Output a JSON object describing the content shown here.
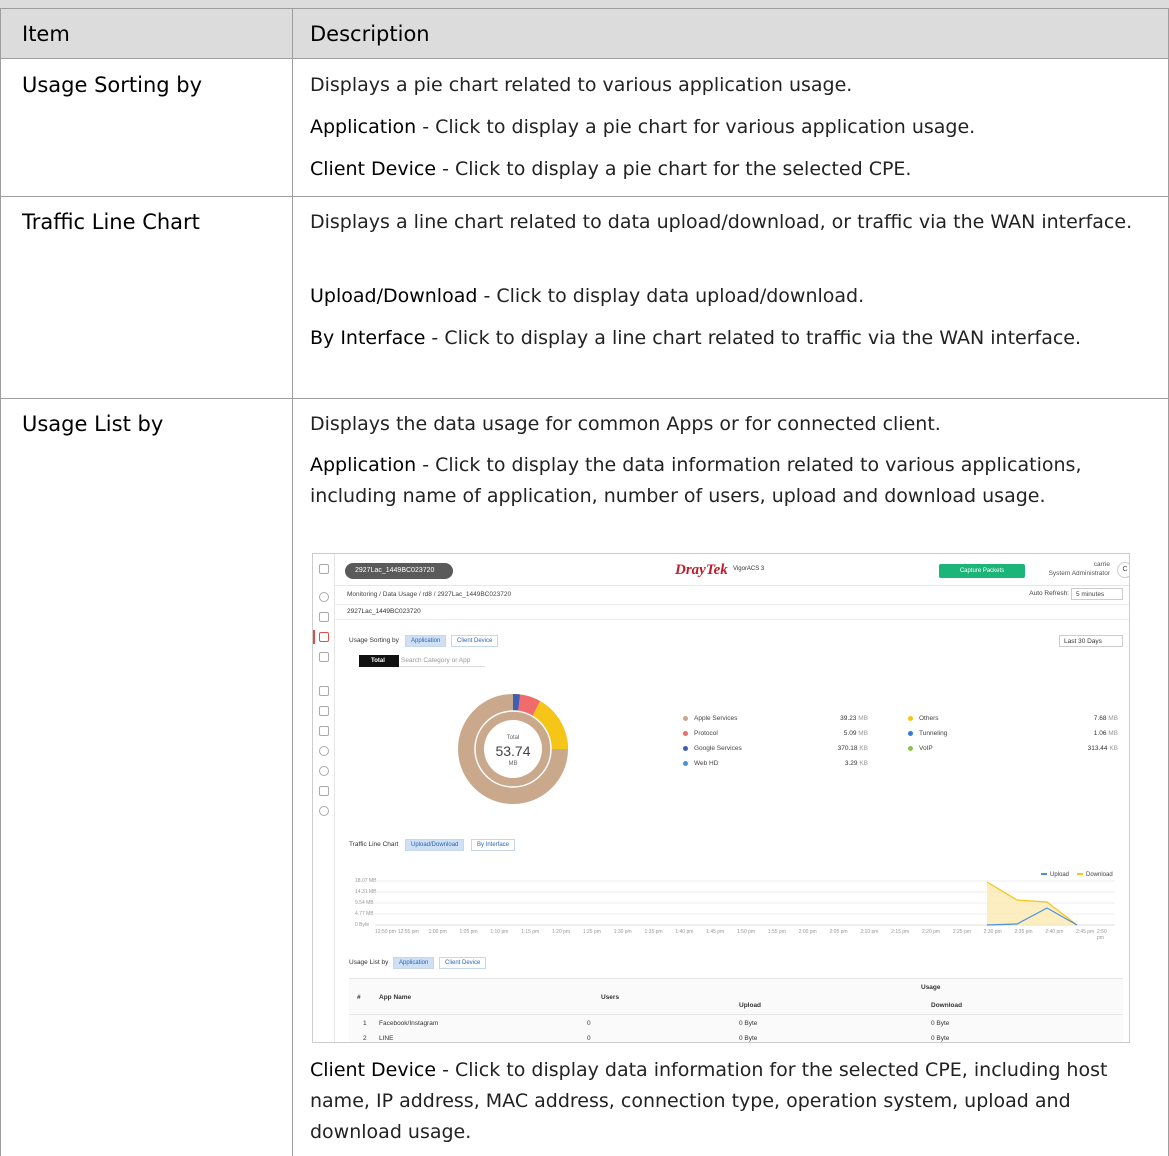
{
  "table": {
    "header": {
      "item": "Item",
      "description": "Description"
    },
    "rows": [
      {
        "item": "Usage Sorting by",
        "lines": [
          {
            "bold": "",
            "text": "Displays a pie chart related to various application usage."
          },
          {
            "bold": "Application",
            "text": " - Click to display a pie chart for various application usage."
          },
          {
            "bold": "Client Device",
            "text": " - Click to display a pie chart for the selected CPE."
          }
        ]
      },
      {
        "item": "Traffic Line Chart",
        "lines": [
          {
            "bold": "",
            "text": "Displays a line chart related to data upload/download, or traffic via the WAN interface."
          },
          {
            "bold": "Upload/Download",
            "text": " - Click to display data upload/download."
          },
          {
            "bold": "By Interface",
            "text": " - Click to display a line chart related to traffic via the WAN interface."
          }
        ]
      },
      {
        "item": "Usage List by",
        "lines": [
          {
            "bold": "",
            "text": "Displays the data usage for common Apps or for connected client."
          },
          {
            "bold": "Application",
            "text": " - Click to display the data information related to various applications, including name of application, number of users, upload and download usage."
          },
          {
            "bold": "Client Device",
            "text": " - Click to display data information for the selected CPE, including host name, IP address, MAC address, connection type, operation system, upload and download usage."
          }
        ]
      }
    ]
  },
  "screenshot": {
    "device": "2927Lac_1449BC023720",
    "logo": "DrayTek",
    "product": "VigorACS 3",
    "capture_button": "Capture Packets",
    "user_name": "carrie",
    "user_role": "System Administrator",
    "avatar_letter": "C",
    "breadcrumb": "Monitoring / Data Usage / rd8 / 2927Lac_1449BC023720",
    "auto_refresh_label": "Auto Refresh:",
    "auto_refresh_value": "5 minutes",
    "device_name": "2927Lac_1449BC023720",
    "usage_sorting_label": "Usage Sorting by",
    "seg_application": "Application",
    "seg_client_device": "Client Device",
    "period": "Last 30 Days",
    "total_tag": "Total",
    "search_placeholder": "Search Category or App",
    "donut_total_label": "Total",
    "donut_total_value": "53.74",
    "donut_total_unit": "MB",
    "legend": [
      {
        "name": "Apple Services",
        "value": "39.23",
        "unit": "MB",
        "color": "#c9a88c"
      },
      {
        "name": "Protocol",
        "value": "5.09",
        "unit": "MB",
        "color": "#f06b6b"
      },
      {
        "name": "Google Services",
        "value": "370.18",
        "unit": "KB",
        "color": "#3b5fb5"
      },
      {
        "name": "Web HD",
        "value": "3.29",
        "unit": "KB",
        "color": "#4a90e2"
      },
      {
        "name": "Others",
        "value": "7.68",
        "unit": "MB",
        "color": "#f5c518"
      },
      {
        "name": "Tunneling",
        "value": "1.06",
        "unit": "MB",
        "color": "#3a7bd5"
      },
      {
        "name": "VoIP",
        "value": "313.44",
        "unit": "KB",
        "color": "#8bc34a"
      }
    ],
    "traffic_label": "Traffic Line Chart",
    "seg_upload_download": "Upload/Download",
    "seg_by_interface": "By Interface",
    "chart_legend_upload": "Upload",
    "chart_legend_download": "Download",
    "y_ticks": [
      "18.07 MB",
      "14.31 MB",
      "9.54 MB",
      "4.77 MB",
      "0 Byte"
    ],
    "x_ticks": [
      "12:50 pm",
      "12:55 pm",
      "1:00 pm",
      "1:05 pm",
      "1:10 pm",
      "1:15 pm",
      "1:20 pm",
      "1:25 pm",
      "1:30 pm",
      "1:35 pm",
      "1:40 pm",
      "1:45 pm",
      "1:50 pm",
      "1:55 pm",
      "2:00 pm",
      "2:05 pm",
      "2:10 pm",
      "2:15 pm",
      "2:20 pm",
      "2:25 pm",
      "2:30 pm",
      "2:35 pm",
      "2:40 pm",
      "2:45 pm",
      "2:50 pm"
    ],
    "usage_list_label": "Usage List by",
    "list_headers": {
      "num": "#",
      "app": "App Name",
      "users": "Users",
      "usage": "Usage",
      "upload": "Upload",
      "download": "Download"
    },
    "list_rows": [
      {
        "num": "1",
        "app": "Facebook/Instagram",
        "users": "0",
        "upload": "0 Byte",
        "download": "0 Byte"
      },
      {
        "num": "2",
        "app": "LINE",
        "users": "0",
        "upload": "0 Byte",
        "download": "0 Byte"
      }
    ]
  }
}
